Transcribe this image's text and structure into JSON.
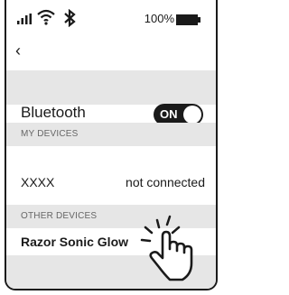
{
  "status_bar": {
    "signal_icon": "signal-bars-icon",
    "wifi_icon": "wifi-icon",
    "bluetooth_icon": "bluetooth-icon",
    "battery_percent": "100%",
    "battery_icon": "battery-icon"
  },
  "nav": {
    "back_icon": "‹"
  },
  "bluetooth": {
    "label": "Bluetooth",
    "toggle_state": "ON"
  },
  "my_devices": {
    "header": "MY DEVICES",
    "items": [
      {
        "name": "XXXX",
        "status": "not connected"
      }
    ]
  },
  "other_devices": {
    "header": "OTHER DEVICES",
    "items": [
      {
        "name": "Razor Sonic Glow"
      }
    ]
  },
  "colors": {
    "section_background": "#e6e6e6",
    "toggle_background": "#1a1a1a",
    "text": "#1a1a1a"
  }
}
